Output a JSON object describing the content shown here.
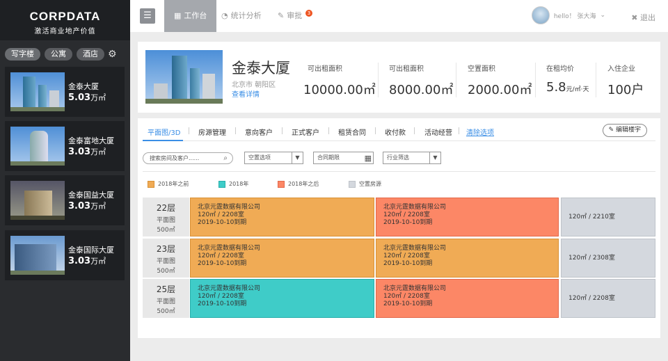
{
  "brand": {
    "name": "CORPDATA",
    "slogan": "激活商业地产价值"
  },
  "categories": [
    "写字楼",
    "公寓",
    "酒店"
  ],
  "buildings": [
    {
      "name": "金泰大厦",
      "area": "5.03",
      "unit": "万㎡"
    },
    {
      "name": "金泰富地大厦",
      "area": "3.03",
      "unit": "万㎡"
    },
    {
      "name": "金泰国益大厦",
      "area": "3.03",
      "unit": "万㎡"
    },
    {
      "name": "金泰国际大厦",
      "area": "3.03",
      "unit": "万㎡"
    }
  ],
  "topbar": {
    "tabs": [
      "工作台",
      "统计分析",
      "审批"
    ],
    "approval_badge": "3",
    "user_greeting": "hello！ 张大海",
    "logout": "退出"
  },
  "header": {
    "title": "金泰大厦",
    "location": "北京市  朝阳区",
    "detail_link": "查看详情",
    "stats": [
      {
        "label": "可出租面积",
        "value": "10000.00",
        "unit": "㎡"
      },
      {
        "label": "可出租面积",
        "value": "8000.00",
        "unit": "㎡"
      },
      {
        "label": "空置面积",
        "value": "2000.00",
        "unit": "㎡"
      },
      {
        "label": "在租均价",
        "value": "5.8",
        "unit": "元/㎡·天"
      },
      {
        "label": "入住企业",
        "value": "100户",
        "unit": ""
      }
    ]
  },
  "subtabs": [
    "平面图/3D",
    "房源管理",
    "意向客户",
    "正式客户",
    "租赁合同",
    "收付款",
    "活动经营",
    "清除选项"
  ],
  "edit_button": "编辑楼宇",
  "filters": {
    "search_placeholder": "搜索房间及客户......",
    "vacancy": "空置选项",
    "contract_date": "合同期限",
    "industry": "行业筛选"
  },
  "legend": [
    {
      "label": "2018年之前",
      "color": "#f0ab55"
    },
    {
      "label": "2018年",
      "color": "#3fccc8"
    },
    {
      "label": "2018年之后",
      "color": "#fc8766"
    },
    {
      "label": "空置房源",
      "color": "#d4d8de"
    }
  ],
  "floors": [
    {
      "floor": "22层",
      "plan": "平面图",
      "area": "500㎡",
      "units": [
        {
          "company": "北京元霆数据有限公司",
          "room": "120㎡ / 2208室",
          "expiry": "2019-10-10到期"
        },
        {
          "company": "北京元霆数据有限公司",
          "room": "120㎡ / 2208室",
          "expiry": "2019-10-10到期"
        },
        {
          "vacant": "120㎡ / 2210室"
        }
      ]
    },
    {
      "floor": "23层",
      "plan": "平面图",
      "area": "500㎡",
      "units": [
        {
          "company": "北京元霆数据有限公司",
          "room": "120㎡ / 2208室",
          "expiry": "2019-10-10到期"
        },
        {
          "company": "北京元霆数据有限公司",
          "room": "120㎡ / 2208室",
          "expiry": "2019-10-10到期"
        },
        {
          "vacant": "120㎡ / 2308室"
        }
      ]
    },
    {
      "floor": "25层",
      "plan": "平面图",
      "area": "500㎡",
      "units": [
        {
          "company": "北京元霆数据有限公司",
          "room": "120㎡ / 2208室",
          "expiry": "2019-10-10到期"
        },
        {
          "company": "北京元霆数据有限公司",
          "room": "120㎡ / 2208室",
          "expiry": "2019-10-10到期"
        },
        {
          "vacant": "120㎡ / 2208室"
        }
      ]
    }
  ]
}
